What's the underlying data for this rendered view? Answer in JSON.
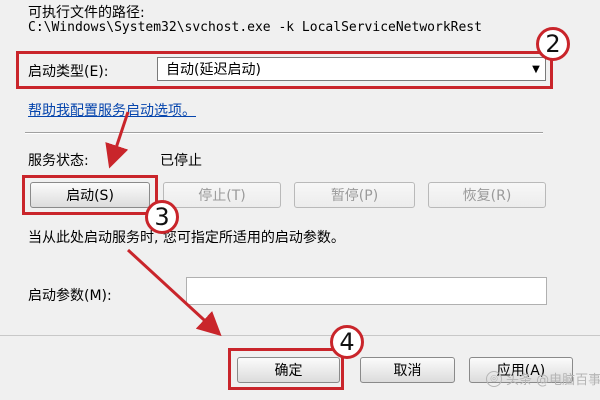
{
  "path": {
    "label": "可执行文件的路径:",
    "value": "C:\\Windows\\System32\\svchost.exe -k LocalServiceNetworkRest"
  },
  "startup_type": {
    "label": "启动类型(E):",
    "selected": "自动(延迟启动)"
  },
  "help_link": "帮助我配置服务启动选项。",
  "service_status": {
    "label": "服务状态:",
    "value": "已停止"
  },
  "buttons": {
    "start": "启动(S)",
    "stop": "停止(T)",
    "pause": "暂停(P)",
    "resume": "恢复(R)"
  },
  "params": {
    "hint": "当从此处启动服务时, 您可指定所适用的启动参数。",
    "label": "启动参数(M):",
    "value": ""
  },
  "dialog_buttons": {
    "ok": "确定",
    "cancel": "取消",
    "apply": "应用(A)"
  },
  "markers": {
    "m2": "2",
    "m3": "3",
    "m4": "4"
  },
  "watermark": "头条 @电脑百事",
  "colors": {
    "annotation_red": "#c9252b",
    "link_blue": "#0645ad"
  }
}
